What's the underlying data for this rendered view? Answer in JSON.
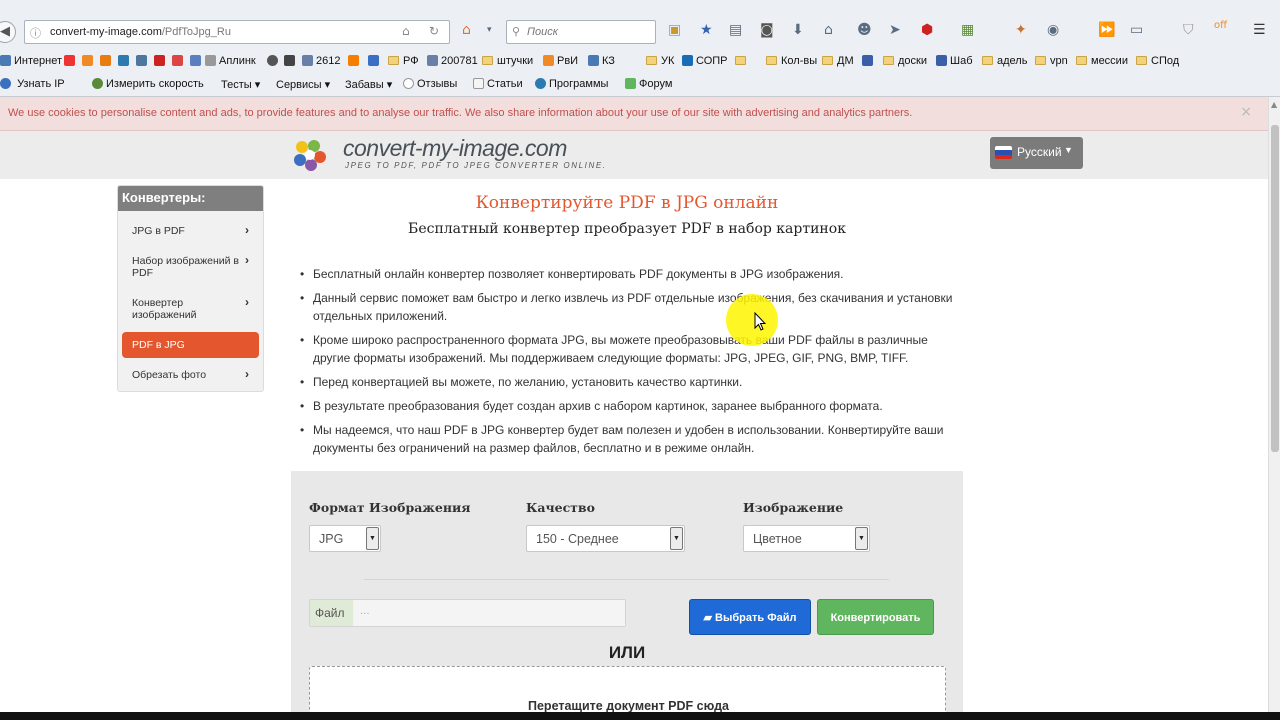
{
  "browser": {
    "url_host": "convert-my-image.com",
    "url_path": "/PdfToJpg_Ru",
    "search_placeholder": "Поиск",
    "back_glyph": "◀"
  },
  "bookmarks_row1": [
    {
      "label": "Интернет",
      "icon": "globe-icon",
      "color": "#4a7ab5"
    },
    {
      "label": "Аплинк",
      "icon": "bookmark-icon",
      "color": "#6b6b6b"
    },
    {
      "label": "2612",
      "icon": "bookmark-icon",
      "color": "#6b6b6b"
    },
    {
      "label": "РФ",
      "icon": "folder-icon",
      "color": "#f2d27a"
    },
    {
      "label": "200781",
      "icon": "folder-icon",
      "color": "#f2d27a"
    },
    {
      "label": "штучки",
      "icon": "folder-icon",
      "color": "#f2d27a"
    },
    {
      "label": "РвИ",
      "icon": "folder-icon",
      "color": "#f2d27a"
    },
    {
      "label": "КЗ",
      "icon": "folder-icon",
      "color": "#f2d27a"
    },
    {
      "label": "УК",
      "icon": "folder-icon",
      "color": "#f2d27a"
    },
    {
      "label": "СОПР",
      "icon": "bookmark-icon",
      "color": "#1a6bb5"
    },
    {
      "label": "Кол-вы",
      "icon": "folder-icon",
      "color": "#f2d27a"
    },
    {
      "label": "ДМ",
      "icon": "folder-icon",
      "color": "#f2d27a"
    },
    {
      "label": "доски",
      "icon": "folder-icon",
      "color": "#f2d27a"
    },
    {
      "label": "Шаб",
      "icon": "bookmark-icon",
      "color": "#3a5ea8"
    },
    {
      "label": "адель",
      "icon": "folder-icon",
      "color": "#f2d27a"
    },
    {
      "label": "vpn",
      "icon": "folder-icon",
      "color": "#f2d27a"
    },
    {
      "label": "мессии",
      "icon": "folder-icon",
      "color": "#f2d27a"
    },
    {
      "label": "СПод",
      "icon": "folder-icon",
      "color": "#f2d27a"
    }
  ],
  "bookmarks_row2": [
    {
      "label": "Узнать IP",
      "icon": "info-icon"
    },
    {
      "label": "Измерить скорость",
      "icon": "speed-icon"
    },
    {
      "label": "Тесты",
      "icon": "none"
    },
    {
      "label": "Сервисы",
      "icon": "none"
    },
    {
      "label": "Забавы",
      "icon": "none"
    },
    {
      "label": "Отзывы",
      "icon": "comment-icon"
    },
    {
      "label": "Статьи",
      "icon": "article-icon"
    },
    {
      "label": "Программы",
      "icon": "gear-icon"
    },
    {
      "label": "Форум",
      "icon": "check-icon"
    }
  ],
  "cookie": {
    "message": "We use cookies to personalise content and ads, to provide features and to analyse our traffic. We also share information about your use of our site with advertising and analytics partners.",
    "close": "×"
  },
  "site": {
    "logo_name": "convert-my-image.com",
    "logo_tagline": "JPEG TO PDF, PDF TO JPEG CONVERTER ONLINE.",
    "language": "Русский"
  },
  "sidebar": {
    "title": "Конвертеры:",
    "items": [
      {
        "label": "JPG в PDF",
        "active": false
      },
      {
        "label": "Набор изображений в PDF",
        "active": false
      },
      {
        "label": "Конвертер изображений",
        "active": false
      },
      {
        "label": "PDF в JPG",
        "active": true
      },
      {
        "label": "Обрезать фото",
        "active": false
      }
    ]
  },
  "main": {
    "title": "Конвертируйте PDF в JPG онлайн",
    "subtitle": "Бесплатный конвертер преобразует PDF в набор картинок",
    "bullets": [
      "Бесплатный онлайн конвертер позволяет конвертировать PDF документы в JPG изображения.",
      "Данный сервис поможет вам быстро и легко извлечь из PDF отдельные изображения, без скачивания и установки отдельных приложений.",
      "Кроме широко распространенного формата JPG, вы можете преобразовывать ваши PDF файлы в различные другие форматы изображений. Мы поддерживаем следующие форматы: JPG, JPEG, GIF, PNG, BMP, TIFF.",
      "Перед конвертацией вы можете, по желанию, установить качество картинки.",
      "В результате преобразования будет создан архив с набором картинок, заранее выбранного формата.",
      "Мы надеемся, что наш PDF в JPG конвертер будет вам полезен и удобен в использовании. Конвертируйте ваши документы без ограничений на размер файлов, бесплатно и в режиме онлайн."
    ]
  },
  "form": {
    "format_label": "Формат Изображения",
    "format_value": "JPG",
    "quality_label": "Качество",
    "quality_value": "150 - Среднее",
    "image_label": "Изображение",
    "image_value": "Цветное",
    "file_label": "Файл",
    "file_placeholder": "...",
    "choose_button": "Выбрать Файл",
    "convert_button": "Конвертировать",
    "or_text": "ИЛИ",
    "drop_text": "Перетащите документ PDF сюда"
  },
  "colors": {
    "accent": "#e4572e",
    "blue_button": "#1f6ad6",
    "green_button": "#5fb65e",
    "cookie_text": "#c0504d"
  }
}
